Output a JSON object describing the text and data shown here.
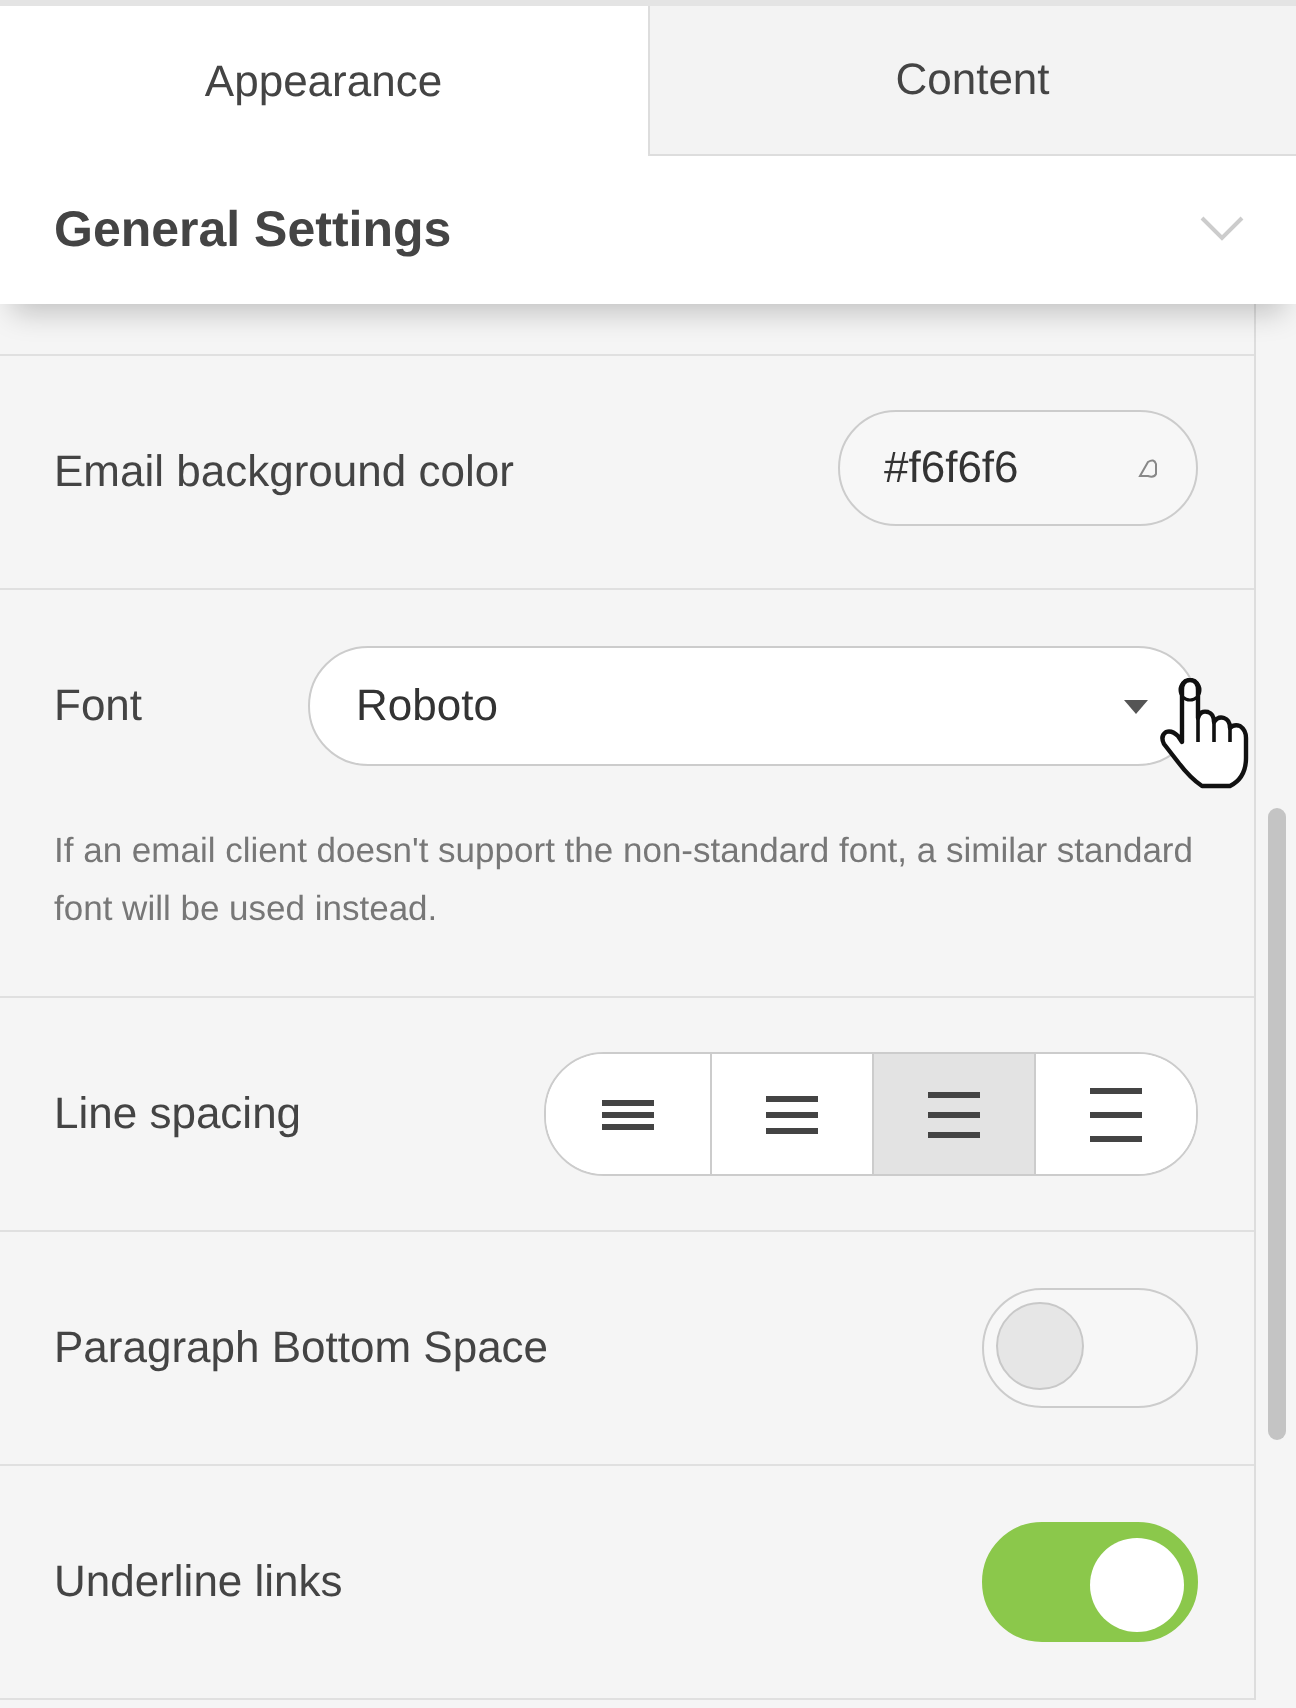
{
  "tabs": [
    {
      "label": "Appearance",
      "selected": true
    },
    {
      "label": "Content",
      "selected": false
    }
  ],
  "section": {
    "title": "General Settings",
    "expanded": false
  },
  "settings": [
    {
      "kind": "color",
      "label": "Email background color",
      "value": "#f6f6f6"
    },
    {
      "kind": "select",
      "label": "Font",
      "value": "Roboto",
      "note": "If an email client doesn't support the non-standard font, a similar standard font will be used instead."
    },
    {
      "kind": "segments",
      "label": "Line spacing",
      "options": [
        {
          "selected": false
        },
        {
          "selected": false
        },
        {
          "selected": true
        },
        {
          "selected": false
        }
      ]
    },
    {
      "kind": "toggle",
      "label": "Paragraph Bottom Space",
      "on": false
    },
    {
      "kind": "toggle",
      "label": "Underline links",
      "on": true
    }
  ]
}
